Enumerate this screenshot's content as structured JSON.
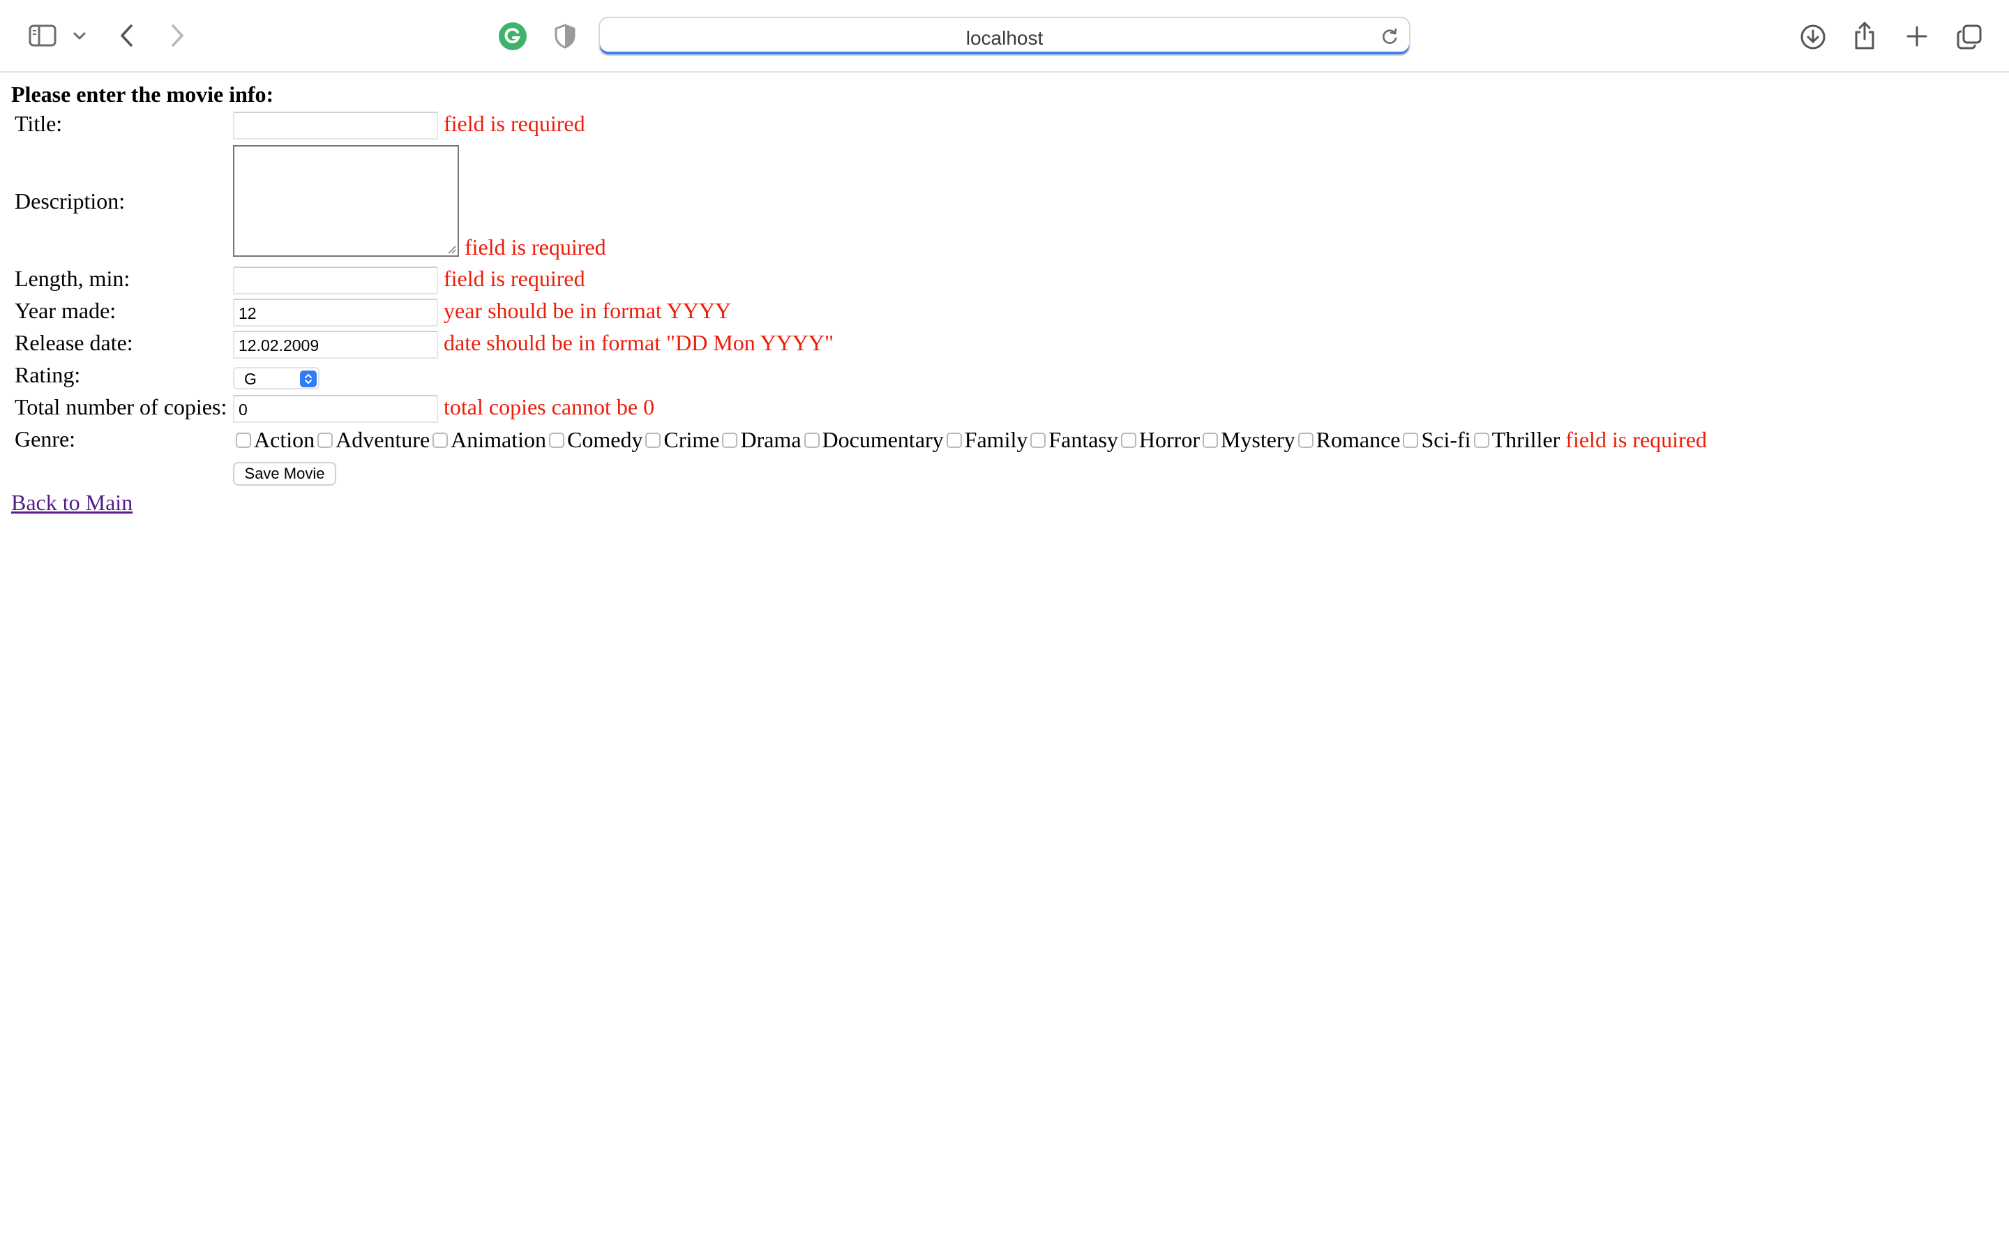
{
  "browser": {
    "url": "localhost",
    "icons": [
      "sidebar-icon",
      "chevron-down-icon",
      "back-arrow-icon",
      "forward-arrow-icon",
      "grammarly-icon",
      "privacy-shield-icon",
      "reload-icon",
      "download-icon",
      "share-icon",
      "new-tab-icon",
      "tab-overview-icon"
    ],
    "accent": "#3b7ff5",
    "grammarly_color": "#3fb36c"
  },
  "form": {
    "heading": "Please enter the movie info:",
    "error_color": "#ee1c0a",
    "title": {
      "label": "Title:",
      "value": "",
      "error": "field is required"
    },
    "description": {
      "label": "Description:",
      "value": "",
      "error": "field is required"
    },
    "length": {
      "label": "Length, min:",
      "value": "",
      "error": "field is required"
    },
    "year": {
      "label": "Year made:",
      "value": "12",
      "error": "year should be in format YYYY"
    },
    "release": {
      "label": "Release date:",
      "value": "12.02.2009",
      "error": "date should be in format \"DD Mon YYYY\""
    },
    "rating": {
      "label": "Rating:",
      "value": "G"
    },
    "copies": {
      "label": "Total number of copies:",
      "value": "0",
      "error": "total copies cannot be 0"
    },
    "genre": {
      "label": "Genre:",
      "options": [
        "Action",
        "Adventure",
        "Animation",
        "Comedy",
        "Crime",
        "Drama",
        "Documentary",
        "Family",
        "Fantasy",
        "Horror",
        "Mystery",
        "Romance",
        "Sci-fi",
        "Thriller"
      ],
      "error": "field is required"
    },
    "save_label": "Save Movie"
  },
  "back_link": "Back to Main"
}
